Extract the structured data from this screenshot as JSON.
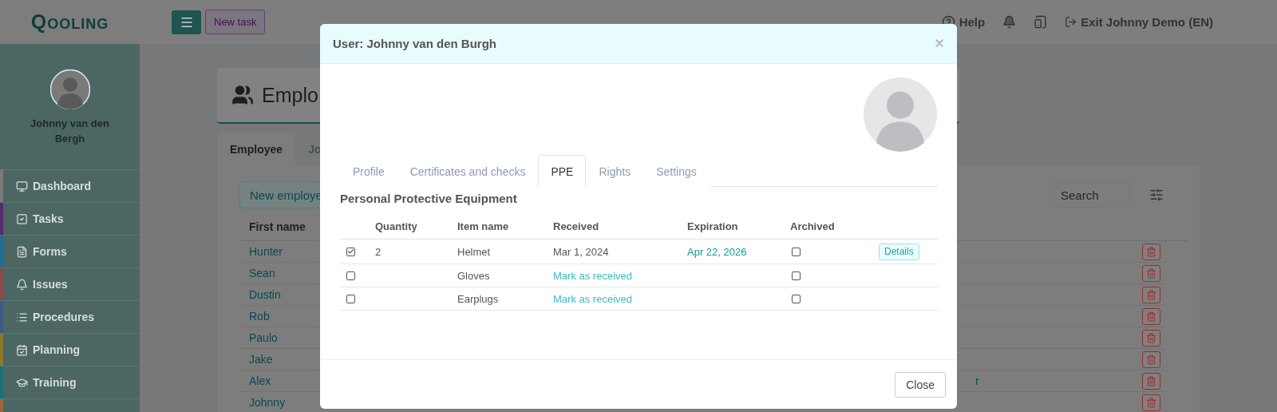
{
  "topbar": {
    "logo": "QOOLING",
    "new_task": "New task",
    "help": "Help",
    "exit": "Exit Johnny Demo (EN)"
  },
  "sidebar": {
    "user_name": "Johnny van den Bergh",
    "items": [
      {
        "label": "Dashboard",
        "color": "#7a7a7a"
      },
      {
        "label": "Tasks",
        "color": "#5a2a6e"
      },
      {
        "label": "Forms",
        "color": "#1f6f92"
      },
      {
        "label": "Issues",
        "color": "#8a4a4a"
      },
      {
        "label": "Procedures",
        "color": "#3e5a82"
      },
      {
        "label": "Planning",
        "color": "#8a7a2a"
      },
      {
        "label": "Training",
        "color": "#1d6f7a"
      },
      {
        "color": "#a0643a"
      }
    ]
  },
  "page": {
    "title": "Emplo",
    "tabs": [
      {
        "label": "Employee",
        "selected": true
      },
      {
        "label": "Jo",
        "selected": false
      }
    ],
    "new_button": "New employe",
    "search": {
      "placeholder": "Search"
    },
    "table": {
      "columns": [
        "First name"
      ],
      "rows": [
        {
          "first_name": "Hunter"
        },
        {
          "first_name": "Sean"
        },
        {
          "first_name": "Dustin"
        },
        {
          "first_name": "Rob"
        },
        {
          "first_name": "Paulo"
        },
        {
          "first_name": "Jake"
        },
        {
          "first_name": "Alex",
          "column_2": "r"
        },
        {
          "first_name": "Johnny"
        }
      ]
    }
  },
  "modal": {
    "title": "User: Johnny van den Burgh",
    "close_symbol": "×",
    "tabs": [
      {
        "label": "Profile",
        "selected": false
      },
      {
        "label": "Certificates and checks",
        "selected": false
      },
      {
        "label": "PPE",
        "selected": true
      },
      {
        "label": "Rights",
        "selected": false
      },
      {
        "label": "Settings",
        "selected": false
      }
    ],
    "section_title": "Personal Protective Equipment",
    "columns": [
      "Quantity",
      "Item name",
      "Received",
      "Expiration",
      "Archived"
    ],
    "rows": [
      {
        "checked": true,
        "quantity": "2",
        "item": "Helmet",
        "received": "Mar 1, 2024",
        "kind": "received",
        "expiration": "Apr 22, 2026",
        "archived": false,
        "action": "Details"
      },
      {
        "checked": false,
        "quantity": "",
        "item": "Gloves",
        "received": "Mark as received",
        "kind": "pending",
        "expiration": "",
        "archived": false,
        "action": ""
      },
      {
        "checked": false,
        "quantity": "",
        "item": "Earplugs",
        "received": "Mark as received",
        "kind": "pending",
        "expiration": "",
        "archived": false,
        "action": ""
      }
    ],
    "footer_button": "Close"
  }
}
